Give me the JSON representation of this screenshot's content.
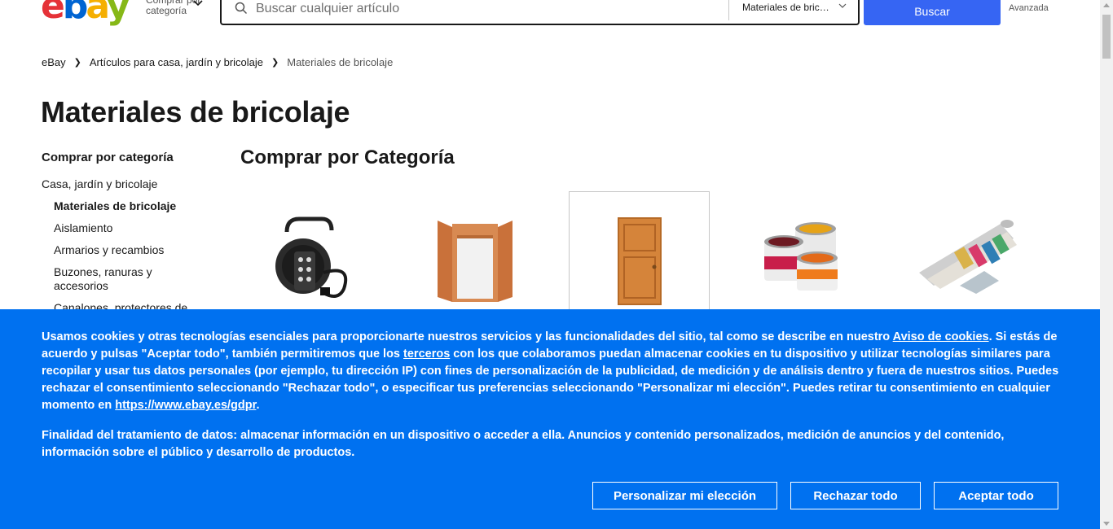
{
  "header": {
    "logo_letters": [
      "e",
      "b",
      "a",
      "y"
    ],
    "shop_by_category": "Comprar por categoría",
    "search_placeholder": "Buscar cualquier artículo",
    "category_select": "Materiales de bric…",
    "search_button": "Buscar",
    "advanced": "Avanzada"
  },
  "breadcrumb": [
    "eBay",
    "Artículos para casa, jardín y bricolaje",
    "Materiales de bricolaje"
  ],
  "page_title": "Materiales de bricolaje",
  "sidebar": {
    "title": "Comprar por categoría",
    "parent": "Casa, jardín y bricolaje",
    "items": [
      "Materiales de bricolaje",
      "Aislamiento",
      "Armarios y recambios",
      "Buzones, ranuras y accesorios",
      "Canalones, protectores de"
    ]
  },
  "categories": {
    "heading": "Comprar por Categoría",
    "tiles": [
      {
        "icon": "cable-reel-icon"
      },
      {
        "icon": "wardrobe-frame-icon"
      },
      {
        "icon": "door-icon"
      },
      {
        "icon": "paint-cans-icon"
      },
      {
        "icon": "wallpaper-rolls-icon"
      }
    ]
  },
  "cookie_banner": {
    "p1_a": "Usamos cookies y otras tecnologías esenciales para proporcionarte nuestros servicios y las funcionalidades del sitio, tal como se describe en nuestro ",
    "link_cookies": "Aviso de cookies",
    "p1_b": ". Si estás de acuerdo y pulsas \"Aceptar todo\", también permitiremos que los ",
    "link_third": "terceros",
    "p1_c": " con los que colaboramos puedan almacenar cookies en tu dispositivo y utilizar tecnologías similares para recopilar y usar tus datos personales (por ejemplo, tu dirección IP) con fines de personalización de la publicidad, de medición y de análisis dentro y fuera de nuestros sitios. Puedes rechazar el consentimiento seleccionando \"Rechazar todo\", o especificar tus preferencias seleccionando \"Personalizar mi elección\". Puedes retirar tu consentimiento en cualquier momento en ",
    "link_gdpr": "https://www.ebay.es/gdpr",
    "p1_d": ".",
    "p2": "Finalidad del tratamiento de datos: almacenar información en un dispositivo o acceder a ella. Anuncios y contenido personalizados, medición de anuncios y del contenido, información sobre el público y desarrollo de productos.",
    "btn_customize": "Personalizar mi elección",
    "btn_reject": "Rechazar todo",
    "btn_accept": "Aceptar todo"
  },
  "colors": {
    "accent": "#3665f3",
    "banner": "#0071f0"
  }
}
